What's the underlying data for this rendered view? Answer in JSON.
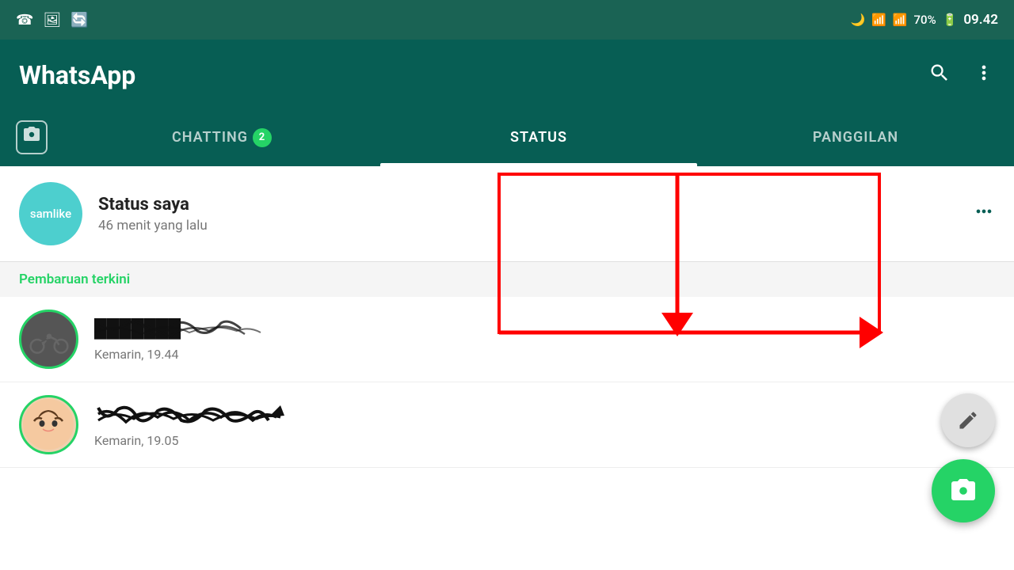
{
  "statusBar": {
    "time": "09.42",
    "battery": "70%",
    "icons": [
      "whatsapp",
      "image",
      "refresh",
      "moon",
      "wifi",
      "signal",
      "battery"
    ]
  },
  "header": {
    "title": "WhatsApp",
    "searchLabel": "search",
    "menuLabel": "menu"
  },
  "tabs": {
    "cameraLabel": "camera",
    "chattingLabel": "CHATTING",
    "chattingBadge": "2",
    "statusLabel": "STATUS",
    "panggilanLabel": "PANGGILAN",
    "activeTab": "STATUS"
  },
  "myStatus": {
    "name": "Status saya",
    "time": "46 menit yang lalu",
    "avatarText": "samlike",
    "moreLabel": "more options"
  },
  "sectionLabel": "Pembaruan terkini",
  "contacts": [
    {
      "id": 1,
      "nameVisible": false,
      "time": "Kemarin, 19.44"
    },
    {
      "id": 2,
      "nameVisible": false,
      "time": "Kemarin, 19.05"
    }
  ],
  "fabs": {
    "pencilLabel": "edit status",
    "cameraLabel": "add status"
  }
}
